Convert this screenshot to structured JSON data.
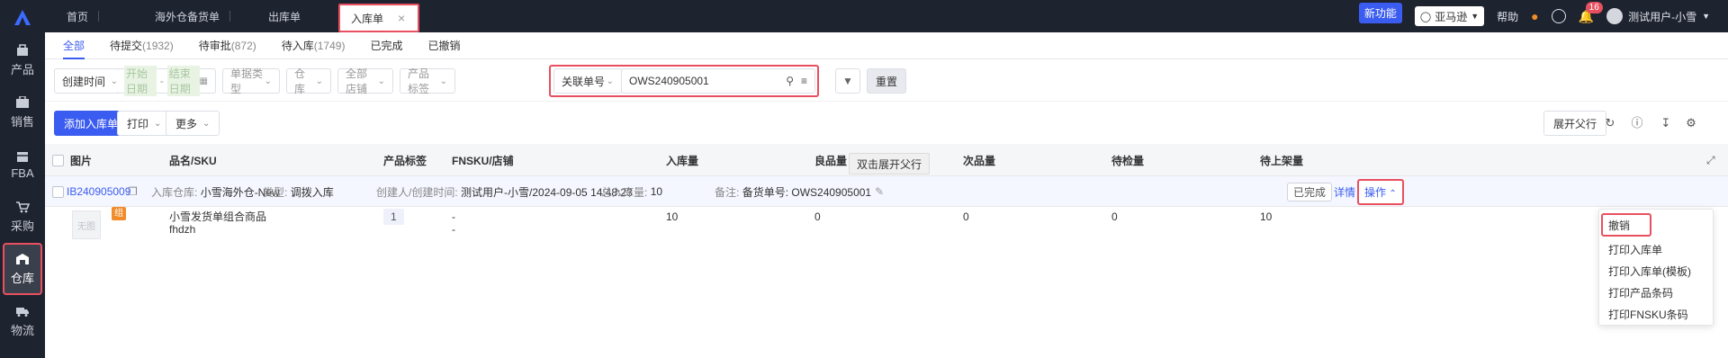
{
  "sidebar": {
    "items": [
      {
        "label": "产品",
        "icon": "product-icon"
      },
      {
        "label": "销售",
        "icon": "sales-icon"
      },
      {
        "label": "FBA",
        "icon": "fba-icon"
      },
      {
        "label": "采购",
        "icon": "purchase-icon"
      },
      {
        "label": "仓库",
        "icon": "warehouse-icon",
        "active": true
      },
      {
        "label": "物流",
        "icon": "logistics-icon"
      }
    ]
  },
  "topbar": {
    "tabs": [
      {
        "label": "首页"
      },
      {
        "label": "海外仓备货单"
      },
      {
        "label": "出库单"
      },
      {
        "label": "入库单",
        "active": true
      }
    ],
    "new_feature": "新功能",
    "shop": "亚马逊",
    "help": "帮助",
    "notification_count": "16",
    "user": "测试用户-小雪"
  },
  "status_tabs": [
    {
      "label": "全部",
      "count": "",
      "active": true
    },
    {
      "label": "待提交",
      "count": "(1932)"
    },
    {
      "label": "待审批",
      "count": "(872)"
    },
    {
      "label": "待入库",
      "count": "(1749)"
    },
    {
      "label": "已完成",
      "count": ""
    },
    {
      "label": "已撤销",
      "count": ""
    }
  ],
  "filters": {
    "date_type": "创建时间",
    "start_date": "开始日期",
    "date_sep": "-",
    "end_date": "结束日期",
    "doc_type": "单据类型",
    "warehouse": "仓库",
    "shop": "全部店铺",
    "product_tag": "产品标签",
    "search_field": "关联单号",
    "search_value": "OWS240905001",
    "reset": "重置"
  },
  "toolbar": {
    "add": "添加入库单",
    "print": "打印",
    "more": "更多",
    "expand_parent": "展开父行"
  },
  "table": {
    "columns": [
      "图片",
      "品名/SKU",
      "产品标签",
      "FNSKU/店铺",
      "入库量",
      "良品量",
      "次品量",
      "待检量",
      "待上架量"
    ],
    "group": {
      "order_no": "IB240905009",
      "warehouse_label": "入库仓库:",
      "warehouse": "小雪海外仓-New",
      "type_label": "类型:",
      "type": "调拨入库",
      "creator_label": "创建人/创建时间:",
      "creator": "测试用户-小雪/2024-09-05 14:48:23",
      "total_label": "总入库量:",
      "total": "10",
      "remark_label": "备注:",
      "remark": "备货单号: OWS240905001",
      "status": "已完成",
      "detail": "详情",
      "action": "操作"
    },
    "item": {
      "thumb_text": "无图",
      "tag": "组",
      "name": "小雪发货单组合商品",
      "sku": "fhdzh",
      "product_tag_qty": "1",
      "fnsku": "-",
      "shop": "-",
      "inbound": "10",
      "good": "0",
      "defect": "0",
      "pending_check": "0",
      "pending_shelf": "10"
    }
  },
  "tooltip": "双击展开父行",
  "action_menu": [
    "撤销",
    "打印入库单",
    "打印入库单(模板)",
    "打印产品条码",
    "打印FNSKU条码"
  ]
}
